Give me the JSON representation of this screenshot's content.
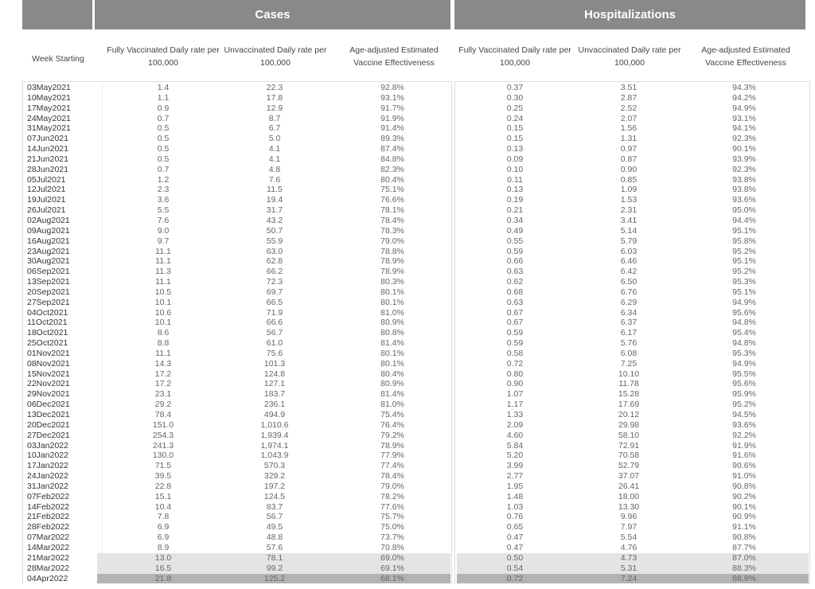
{
  "header": {
    "cases": "Cases",
    "hospitalizations": "Hospitalizations"
  },
  "columns": {
    "week": "Week Starting",
    "cases": [
      "Fully Vaccinated Daily rate per 100,000",
      "Unvaccinated Daily rate per 100,000",
      "Age-adjusted Estimated Vaccine Effectiveness"
    ],
    "hospitalizations": [
      "Fully Vaccinated Daily rate per 100,000",
      "Unvaccinated Daily rate per 100,000",
      "Age-adjusted Estimated Vaccine Effectiveness"
    ]
  },
  "highlight_colors": {
    "light": "#e4e4e4",
    "dark": "#b3b3b3"
  },
  "rows": [
    [
      "03May2021",
      "1.4",
      "22.3",
      "92.8%",
      "0.37",
      "3.51",
      "94.3%",
      ""
    ],
    [
      "10May2021",
      "1.1",
      "17.8",
      "93.1%",
      "0.30",
      "2.87",
      "94.2%",
      ""
    ],
    [
      "17May2021",
      "0.9",
      "12.9",
      "91.7%",
      "0.25",
      "2.52",
      "94.9%",
      ""
    ],
    [
      "24May2021",
      "0.7",
      "8.7",
      "91.9%",
      "0.24",
      "2.07",
      "93.1%",
      ""
    ],
    [
      "31May2021",
      "0.5",
      "6.7",
      "91.4%",
      "0.15",
      "1.56",
      "94.1%",
      ""
    ],
    [
      "07Jun2021",
      "0.5",
      "5.0",
      "89.3%",
      "0.15",
      "1.31",
      "92.3%",
      ""
    ],
    [
      "14Jun2021",
      "0.5",
      "4.1",
      "87.4%",
      "0.13",
      "0.97",
      "90.1%",
      ""
    ],
    [
      "21Jun2021",
      "0.5",
      "4.1",
      "84.8%",
      "0.09",
      "0.87",
      "93.9%",
      ""
    ],
    [
      "28Jun2021",
      "0.7",
      "4.8",
      "82.3%",
      "0.10",
      "0.90",
      "92.3%",
      ""
    ],
    [
      "05Jul2021",
      "1.2",
      "7.6",
      "80.4%",
      "0.11",
      "0.85",
      "93.8%",
      ""
    ],
    [
      "12Jul2021",
      "2.3",
      "11.5",
      "75.1%",
      "0.13",
      "1.09",
      "93.8%",
      ""
    ],
    [
      "19Jul2021",
      "3.6",
      "19.4",
      "76.6%",
      "0.19",
      "1.53",
      "93.6%",
      ""
    ],
    [
      "26Jul2021",
      "5.5",
      "31.7",
      "78.1%",
      "0.21",
      "2.31",
      "95.0%",
      ""
    ],
    [
      "02Aug2021",
      "7.6",
      "43.2",
      "78.4%",
      "0.34",
      "3.41",
      "94.4%",
      ""
    ],
    [
      "09Aug2021",
      "9.0",
      "50.7",
      "78.3%",
      "0.49",
      "5.14",
      "95.1%",
      ""
    ],
    [
      "16Aug2021",
      "9.7",
      "55.9",
      "79.0%",
      "0.55",
      "5.79",
      "95.8%",
      ""
    ],
    [
      "23Aug2021",
      "11.1",
      "63.0",
      "78.8%",
      "0.59",
      "6.03",
      "95.2%",
      ""
    ],
    [
      "30Aug2021",
      "11.1",
      "62.8",
      "78.9%",
      "0.66",
      "6.46",
      "95.1%",
      ""
    ],
    [
      "06Sep2021",
      "11.3",
      "66.2",
      "78.9%",
      "0.63",
      "6.42",
      "95.2%",
      ""
    ],
    [
      "13Sep2021",
      "11.1",
      "72.3",
      "80.3%",
      "0.62",
      "6.50",
      "95.3%",
      ""
    ],
    [
      "20Sep2021",
      "10.5",
      "69.7",
      "80.1%",
      "0.68",
      "6.76",
      "95.1%",
      ""
    ],
    [
      "27Sep2021",
      "10.1",
      "66.5",
      "80.1%",
      "0.63",
      "6.29",
      "94.9%",
      ""
    ],
    [
      "04Oct2021",
      "10.6",
      "71.9",
      "81.0%",
      "0.67",
      "6.34",
      "95.6%",
      ""
    ],
    [
      "11Oct2021",
      "10.1",
      "66.6",
      "80.9%",
      "0.67",
      "6.37",
      "94.8%",
      ""
    ],
    [
      "18Oct2021",
      "8.6",
      "56.7",
      "80.8%",
      "0.59",
      "6.17",
      "95.4%",
      ""
    ],
    [
      "25Oct2021",
      "8.8",
      "61.0",
      "81.4%",
      "0.59",
      "5.76",
      "94.8%",
      ""
    ],
    [
      "01Nov2021",
      "11.1",
      "75.6",
      "80.1%",
      "0.58",
      "6.08",
      "95.3%",
      ""
    ],
    [
      "08Nov2021",
      "14.3",
      "101.3",
      "80.1%",
      "0.72",
      "7.25",
      "94.9%",
      ""
    ],
    [
      "15Nov2021",
      "17.2",
      "124.8",
      "80.4%",
      "0.80",
      "10.10",
      "95.5%",
      ""
    ],
    [
      "22Nov2021",
      "17.2",
      "127.1",
      "80.9%",
      "0.90",
      "11.78",
      "95.6%",
      ""
    ],
    [
      "29Nov2021",
      "23.1",
      "183.7",
      "81.4%",
      "1.07",
      "15.28",
      "95.9%",
      ""
    ],
    [
      "06Dec2021",
      "29.2",
      "236.1",
      "81.0%",
      "1.17",
      "17.69",
      "95.2%",
      ""
    ],
    [
      "13Dec2021",
      "78.4",
      "494.9",
      "75.4%",
      "1.33",
      "20.12",
      "94.5%",
      ""
    ],
    [
      "20Dec2021",
      "151.0",
      "1,010.6",
      "76.4%",
      "2.09",
      "29.98",
      "93.6%",
      ""
    ],
    [
      "27Dec2021",
      "254.3",
      "1,939.4",
      "79.2%",
      "4.60",
      "58.10",
      "92.2%",
      ""
    ],
    [
      "03Jan2022",
      "241.3",
      "1,974.1",
      "78.9%",
      "5.84",
      "72.91",
      "91.9%",
      ""
    ],
    [
      "10Jan2022",
      "130.0",
      "1,043.9",
      "77.9%",
      "5.20",
      "70.58",
      "91.6%",
      ""
    ],
    [
      "17Jan2022",
      "71.5",
      "570.3",
      "77.4%",
      "3.99",
      "52.79",
      "90.6%",
      ""
    ],
    [
      "24Jan2022",
      "39.5",
      "329.2",
      "78.4%",
      "2.77",
      "37.07",
      "91.0%",
      ""
    ],
    [
      "31Jan2022",
      "22.8",
      "197.2",
      "79.0%",
      "1.95",
      "26.41",
      "90.8%",
      ""
    ],
    [
      "07Feb2022",
      "15.1",
      "124.5",
      "78.2%",
      "1.48",
      "18.00",
      "90.2%",
      ""
    ],
    [
      "14Feb2022",
      "10.4",
      "83.7",
      "77.6%",
      "1.03",
      "13.30",
      "90.1%",
      ""
    ],
    [
      "21Feb2022",
      "7.8",
      "56.7",
      "75.7%",
      "0.76",
      "9.96",
      "90.9%",
      ""
    ],
    [
      "28Feb2022",
      "6.9",
      "49.5",
      "75.0%",
      "0.65",
      "7.97",
      "91.1%",
      ""
    ],
    [
      "07Mar2022",
      "6.9",
      "48.8",
      "73.7%",
      "0.47",
      "5.54",
      "90.8%",
      ""
    ],
    [
      "14Mar2022",
      "8.9",
      "57.6",
      "70.8%",
      "0.47",
      "4.76",
      "87.7%",
      ""
    ],
    [
      "21Mar2022",
      "13.0",
      "78.1",
      "69.0%",
      "0.50",
      "4.73",
      "87.0%",
      "light"
    ],
    [
      "28Mar2022",
      "16.5",
      "99.2",
      "69.1%",
      "0.54",
      "5.31",
      "88.3%",
      "light"
    ],
    [
      "04Apr2022",
      "21.8",
      "125.2",
      "68.1%",
      "0.72",
      "7.24",
      "88.9%",
      "dark"
    ]
  ]
}
